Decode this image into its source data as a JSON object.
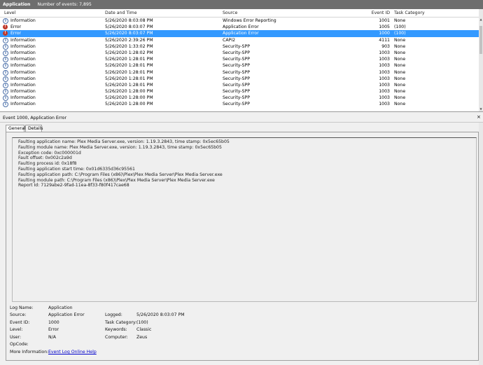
{
  "titlebar": {
    "title": "Application",
    "event_count": "Number of events: 7,895"
  },
  "columns": {
    "level": "Level",
    "date": "Date and Time",
    "source": "Source",
    "event_id": "Event ID",
    "task_category": "Task Category"
  },
  "rows": [
    {
      "icon": "info-icon",
      "level": "Information",
      "date": "5/26/2020 8:03:08 PM",
      "source": "Windows Error Reporting",
      "event_id": "1001",
      "category": "None",
      "selected": false
    },
    {
      "icon": "error-icon",
      "level": "Error",
      "date": "5/26/2020 8:03:07 PM",
      "source": "Application Error",
      "event_id": "1005",
      "category": "(100)",
      "selected": false
    },
    {
      "icon": "error-icon",
      "level": "Error",
      "date": "5/26/2020 8:03:07 PM",
      "source": "Application Error",
      "event_id": "1000",
      "category": "(100)",
      "selected": true
    },
    {
      "icon": "info-icon",
      "level": "Information",
      "date": "5/26/2020 2:39:26 PM",
      "source": "CAPI2",
      "event_id": "4111",
      "category": "None",
      "selected": false
    },
    {
      "icon": "info-icon",
      "level": "Information",
      "date": "5/26/2020 1:33:02 PM",
      "source": "Security-SPP",
      "event_id": "903",
      "category": "None",
      "selected": false
    },
    {
      "icon": "info-icon",
      "level": "Information",
      "date": "5/26/2020 1:28:02 PM",
      "source": "Security-SPP",
      "event_id": "1003",
      "category": "None",
      "selected": false
    },
    {
      "icon": "info-icon",
      "level": "Information",
      "date": "5/26/2020 1:28:01 PM",
      "source": "Security-SPP",
      "event_id": "1003",
      "category": "None",
      "selected": false
    },
    {
      "icon": "info-icon",
      "level": "Information",
      "date": "5/26/2020 1:28:01 PM",
      "source": "Security-SPP",
      "event_id": "1003",
      "category": "None",
      "selected": false
    },
    {
      "icon": "info-icon",
      "level": "Information",
      "date": "5/26/2020 1:28:01 PM",
      "source": "Security-SPP",
      "event_id": "1003",
      "category": "None",
      "selected": false
    },
    {
      "icon": "info-icon",
      "level": "Information",
      "date": "5/26/2020 1:28:01 PM",
      "source": "Security-SPP",
      "event_id": "1003",
      "category": "None",
      "selected": false
    },
    {
      "icon": "info-icon",
      "level": "Information",
      "date": "5/26/2020 1:28:01 PM",
      "source": "Security-SPP",
      "event_id": "1003",
      "category": "None",
      "selected": false
    },
    {
      "icon": "info-icon",
      "level": "Information",
      "date": "5/26/2020 1:28:00 PM",
      "source": "Security-SPP",
      "event_id": "1003",
      "category": "None",
      "selected": false
    },
    {
      "icon": "info-icon",
      "level": "Information",
      "date": "5/26/2020 1:28:00 PM",
      "source": "Security-SPP",
      "event_id": "1003",
      "category": "None",
      "selected": false
    },
    {
      "icon": "info-icon",
      "level": "Information",
      "date": "5/26/2020 1:28:00 PM",
      "source": "Security-SPP",
      "event_id": "1003",
      "category": "None",
      "selected": false
    }
  ],
  "detail": {
    "title": "Event 1000, Application Error",
    "close": "×",
    "tabs": {
      "general": "General",
      "details": "Details"
    },
    "description": [
      "Faulting application name: Plex Media Server.exe, version: 1.19.3.2843, time stamp: 0x5ec65b05",
      "Faulting module name: Plex Media Server.exe, version: 1.19.3.2843, time stamp: 0x5ec65b05",
      "Exception code: 0xc000001d",
      "Fault offset: 0x002c2a9d",
      "Faulting process id: 0x18f8",
      "Faulting application start time: 0x01d6335d36c95561",
      "Faulting application path: C:\\Program Files (x86)\\Plex\\Plex Media Server\\Plex Media Server.exe",
      "Faulting module path: C:\\Program Files (x86)\\Plex\\Plex Media Server\\Plex Media Server.exe",
      "Report Id: 7129abe2-9fad-11ea-8f33-f80f417cae68"
    ],
    "fields": {
      "log_name_label": "Log Name:",
      "log_name": "Application",
      "source_label": "Source:",
      "source": "Application Error",
      "logged_label": "Logged:",
      "logged": "5/26/2020 8:03:07 PM",
      "event_id_label": "Event ID:",
      "event_id": "1000",
      "task_cat_label": "Task Category:",
      "task_cat": "(100)",
      "level_label": "Level:",
      "level": "Error",
      "keywords_label": "Keywords:",
      "keywords": "Classic",
      "user_label": "User:",
      "user": "N/A",
      "computer_label": "Computer:",
      "computer": "Zeus",
      "opcode_label": "OpCode:",
      "more_info_label": "More Information:",
      "more_info_link": "Event Log Online Help"
    }
  }
}
